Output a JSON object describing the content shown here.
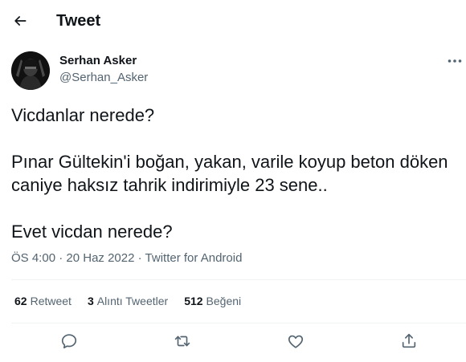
{
  "header": {
    "title": "Tweet",
    "back_icon": "arrow-left-icon"
  },
  "author": {
    "name": "Serhan Asker",
    "handle": "@Serhan_Asker"
  },
  "tweet": {
    "text": "Vicdanlar nerede?\n\nPınar Gültekin'i boğan, yakan, varile koyup beton döken caniye haksız tahrik indirimiyle 23 sene..\n\nEvet vicdan nerede?"
  },
  "meta": {
    "time": "ÖS 4:00",
    "separator": "·",
    "date": "20 Haz 2022",
    "source": "Twitter for Android"
  },
  "stats": {
    "retweets": {
      "count": "62",
      "label": "Retweet"
    },
    "quotes": {
      "count": "3",
      "label": "Alıntı Tweetler"
    },
    "likes": {
      "count": "512",
      "label": "Beğeni"
    }
  },
  "actions": [
    "reply-icon",
    "retweet-icon",
    "like-icon",
    "share-icon"
  ],
  "colors": {
    "text": "#0f1419",
    "secondary": "#536471",
    "divider": "#eff3f4"
  }
}
